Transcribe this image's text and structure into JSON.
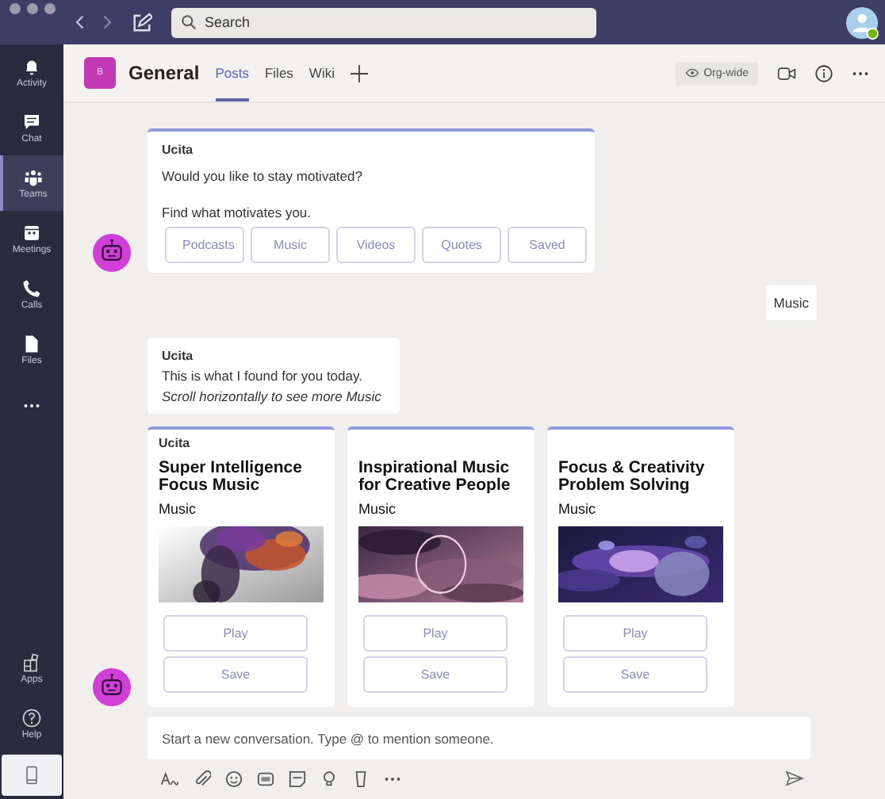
{
  "top_bar": {
    "search_placeholder": "Search"
  },
  "rail": {
    "items": [
      {
        "kind": "bell",
        "label": "Activity",
        "selected": false
      },
      {
        "kind": "chat",
        "label": "Chat",
        "selected": false
      },
      {
        "kind": "teams",
        "label": "Teams",
        "selected": true
      },
      {
        "kind": "calendar",
        "label": "Meetings",
        "selected": false
      },
      {
        "kind": "phone",
        "label": "Calls",
        "selected": false
      },
      {
        "kind": "file",
        "label": "Files",
        "selected": false
      },
      {
        "kind": "more",
        "selected": false
      }
    ],
    "bottom_items": [
      {
        "kind": "apps",
        "label": "Apps",
        "selected": false
      },
      {
        "kind": "help",
        "label": "Help",
        "selected": false
      },
      {
        "kind": "device",
        "selected": true
      }
    ]
  },
  "channel": {
    "initial": "B",
    "name": "General",
    "tabs": [
      {
        "label": "Posts",
        "selected": true
      },
      {
        "label": "Files",
        "selected": false
      },
      {
        "label": "Wiki",
        "selected": false
      }
    ],
    "visibility": "Org-wide"
  },
  "messages": [
    {
      "kind": "card",
      "sender": "Ucita",
      "avatar": true,
      "lines": [
        {
          "text": "Would you like to stay motivated?",
          "italic": false
        },
        {
          "text": "Find what motivates you.",
          "italic": false
        }
      ],
      "buttons": [
        "Podcasts",
        "Music",
        "Videos",
        "Quotes",
        "Saved"
      ]
    },
    {
      "kind": "reply",
      "text": "Music"
    },
    {
      "kind": "card",
      "sender": "Ucita",
      "avatar": false,
      "lines": [
        {
          "text": "This is what I found for you today.",
          "italic": false
        },
        {
          "text": "Scroll horizontally to see more Music",
          "italic": true
        }
      ]
    },
    {
      "kind": "carousel",
      "avatar": true,
      "cards": [
        {
          "sender": "Ucita",
          "title": "Super Intelligence Focus Music",
          "subtitle": "Music",
          "buttons": [
            "Play",
            "Save"
          ]
        },
        {
          "title": "Inspirational Music for Creative People",
          "subtitle": "Music",
          "buttons": [
            "Play",
            "Save"
          ]
        },
        {
          "title": "Focus & Creativity Problem Solving",
          "subtitle": "Music",
          "buttons": [
            "Play",
            "Save"
          ]
        }
      ]
    }
  ],
  "compose": {
    "placeholder": "Start a new conversation. Type @ to mention someone."
  }
}
